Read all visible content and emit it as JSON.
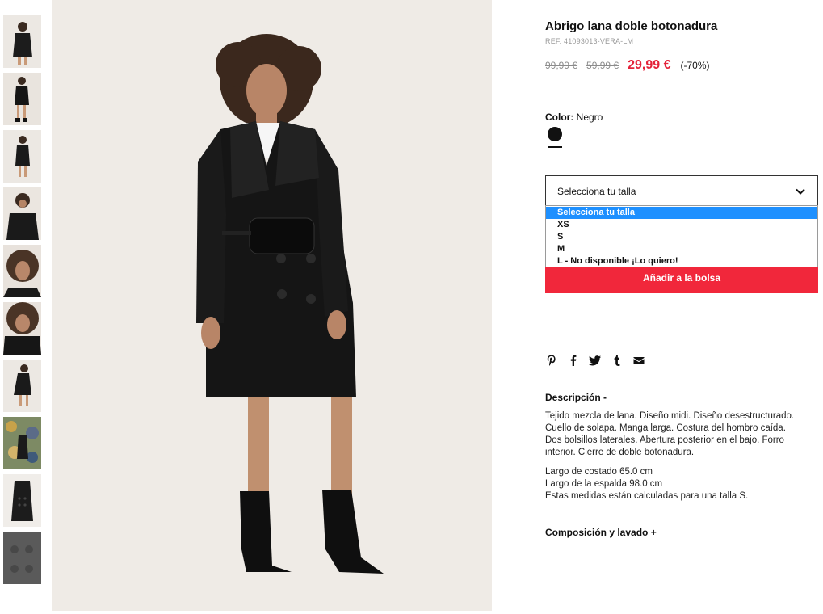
{
  "product": {
    "title": "Abrigo lana doble botonadura",
    "ref": "REF. 41093013-VERA-LM",
    "price_original": "99,99 €",
    "price_previous": "59,99 €",
    "price_current": "29,99 €",
    "discount": "(-70%)"
  },
  "color": {
    "label": "Color:",
    "value": "Negro",
    "swatch_hex": "#111111"
  },
  "size": {
    "selected_label": "Selecciona tu talla",
    "options": [
      "Selecciona tu talla",
      "XS",
      "S",
      "M",
      "L - No disponible ¡Lo quiero!"
    ]
  },
  "cart": {
    "add_label": "Añadir a la bolsa",
    "accent_hex": "#f1273b"
  },
  "share": {
    "icons": [
      "pinterest-icon",
      "facebook-icon",
      "twitter-icon",
      "tumblr-icon",
      "email-icon"
    ]
  },
  "description": {
    "heading": "Descripción -",
    "lines": [
      "Tejido mezcla de lana. Diseño midi. Diseño desestructurado.",
      "Cuello de solapa. Manga larga. Costura del hombro caída.",
      "Dos bolsillos laterales. Abertura posterior en el bajo. Forro",
      "interior. Cierre de doble botonadura."
    ],
    "measures": [
      "Largo de costado 65.0 cm",
      "Largo de la espalda 98.0 cm",
      "Estas medidas están calculadas para una talla S."
    ]
  },
  "composition": {
    "heading": "Composición y lavado +"
  }
}
